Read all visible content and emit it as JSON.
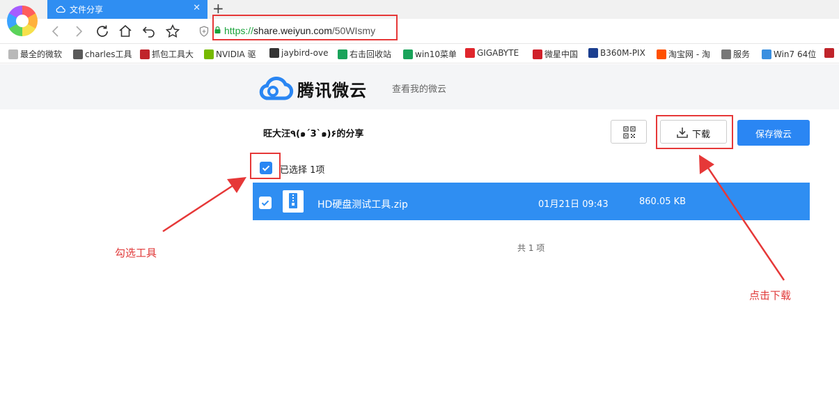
{
  "browser": {
    "tab_title": "文件分享",
    "tab_close": "✕",
    "new_tab": "+",
    "url_scheme": "https://",
    "url_host": "share.weiyun.com",
    "url_path": "/50WIsmy"
  },
  "bookmarks": [
    {
      "label": "最全的微软",
      "color": "#b9b9b9"
    },
    {
      "label": "charles工具",
      "color": "#5a5a5a"
    },
    {
      "label": "抓包工具大",
      "color": "#c0242b"
    },
    {
      "label": "NVIDIA 驱",
      "color": "#76b900"
    },
    {
      "label": "jaybird-ove",
      "color": "#333333"
    },
    {
      "label": "右击回收站",
      "color": "#1aa35a"
    },
    {
      "label": "win10菜单",
      "color": "#1aa35a"
    },
    {
      "label": "GIGABYTE",
      "color": "#e0262c"
    },
    {
      "label": "微星中国",
      "color": "#d0202a"
    },
    {
      "label": "B360M-PIX",
      "color": "#1c3f8f"
    },
    {
      "label": "淘宝网 - 淘",
      "color": "#ff5000"
    },
    {
      "label": "服务",
      "color": "#777777"
    },
    {
      "label": "Win7 64位",
      "color": "#3a8fe0"
    }
  ],
  "site": {
    "logo_text": "腾讯微云",
    "header_link": "查看我的微云",
    "share_title": "旺大汪٩(๑´3`๑)۶的分享",
    "download_label": "下载",
    "save_label": "保存微云",
    "selected_text": "已选择 1项",
    "file": {
      "name": "HD硬盘测试工具.zip",
      "date": "01月21日 09:43",
      "size": "860.05 KB"
    },
    "total_text": "共 1 项"
  },
  "annotations": {
    "select_hint": "勾选工具",
    "download_hint": "点击下载"
  },
  "colors": {
    "accent": "#2f8ef2",
    "annotation": "#e63838"
  }
}
